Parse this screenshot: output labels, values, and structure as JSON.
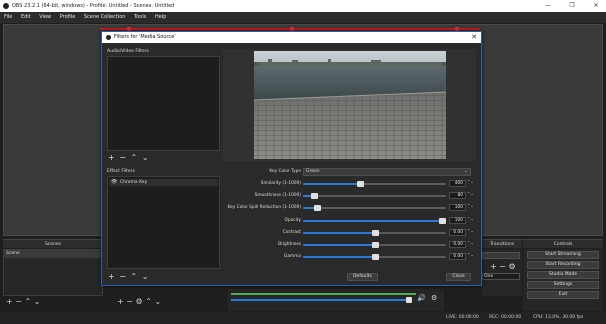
{
  "window": {
    "title": "OBS 23.2.1 (64-bit, windows) - Profile: Untitled - Scenes: Untitled",
    "minimize": "—",
    "maximize": "❐",
    "close": "✕"
  },
  "menu": [
    "File",
    "Edit",
    "View",
    "Profile",
    "Scene Collection",
    "Tools",
    "Help"
  ],
  "docks": {
    "scenes": {
      "title": "Scenes",
      "items": [
        "Scene"
      ]
    },
    "transitions": {
      "title": "Transitions",
      "value": "One"
    },
    "controls": {
      "title": "Controls",
      "buttons": [
        "Start Streaming",
        "Start Recording",
        "Studio Mode",
        "Settings",
        "Exit"
      ]
    }
  },
  "status": {
    "live": "LIVE: 00:00:00",
    "rec": "REC: 00:00:00",
    "cpu": "CPU: 13.0%, 30.00 fps"
  },
  "dialog": {
    "title": "Filters for 'Media Source'",
    "audio_video_label": "Audio/Video Filters",
    "effect_label": "Effect Filters",
    "effect_items": [
      "Chroma Key"
    ],
    "properties": {
      "key_color_type": {
        "label": "Key Color Type",
        "value": "Green"
      },
      "similarity": {
        "label": "Similarity (1-1000)",
        "value": "400",
        "fraction": 0.4
      },
      "smoothness": {
        "label": "Smoothness (1-1000)",
        "value": "80",
        "fraction": 0.08
      },
      "spill": {
        "label": "Key Color Spill Reduction (1-1000)",
        "value": "100",
        "fraction": 0.1
      },
      "opacity": {
        "label": "Opacity",
        "value": "100",
        "fraction": 1.0
      },
      "contrast": {
        "label": "Contrast",
        "value": "0.00",
        "fraction": 0.5
      },
      "brightness": {
        "label": "Brightness",
        "value": "0.00",
        "fraction": 0.5
      },
      "gamma": {
        "label": "Gamma",
        "value": "0.00",
        "fraction": 0.5
      }
    },
    "defaults_label": "Defaults",
    "close_label": "Close"
  },
  "colors": {
    "accent": "#2a7ad8",
    "preview_border": "#d01818",
    "dialog_border": "#2a5fb0"
  }
}
